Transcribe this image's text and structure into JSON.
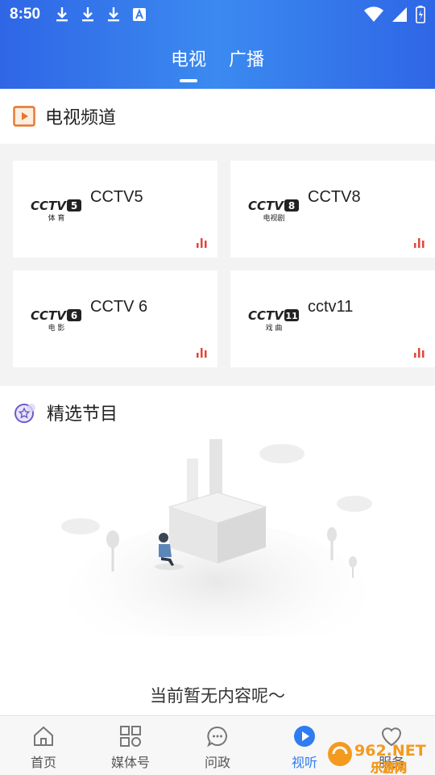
{
  "status_bar": {
    "time": "8:50"
  },
  "header_tabs": [
    {
      "label": "电视",
      "active": true
    },
    {
      "label": "广播",
      "active": false
    }
  ],
  "tv_section": {
    "title": "电视频道",
    "icon": "play-square-icon"
  },
  "channels": [
    {
      "name": "CCTV5",
      "logo_number": "5",
      "logo_sub": "体 育"
    },
    {
      "name": "CCTV8",
      "logo_number": "8",
      "logo_sub": "电视剧"
    },
    {
      "name": "CCTV 6",
      "logo_number": "6",
      "logo_sub": "电 影"
    },
    {
      "name": "cctv11",
      "logo_number": "11",
      "logo_sub": "戏 曲"
    }
  ],
  "featured_section": {
    "title": "精选节目",
    "icon": "star-badge-icon",
    "empty_text": "当前暂无内容呢～"
  },
  "bottom_nav": [
    {
      "label": "首页",
      "icon": "home-icon",
      "active": false
    },
    {
      "label": "媒体号",
      "icon": "grid-icon",
      "active": false
    },
    {
      "label": "问政",
      "icon": "chat-icon",
      "active": false
    },
    {
      "label": "视听",
      "icon": "play-circle-icon",
      "active": true
    },
    {
      "label": "服务",
      "icon": "heart-service-icon",
      "active": false
    }
  ],
  "watermark": {
    "brand": "962.NET",
    "site": "乐游网"
  },
  "colors": {
    "accent": "#2f7cf0",
    "header": "#3478ec",
    "signal": "#e5443a",
    "tv_icon": "#e8752b",
    "featured_icon": "#6a5acd"
  }
}
